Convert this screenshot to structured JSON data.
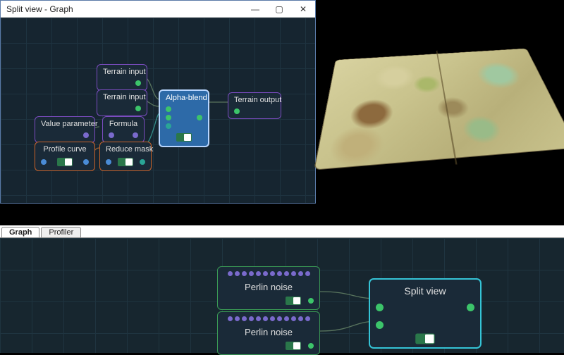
{
  "window": {
    "title": "Split view - Graph",
    "buttons": {
      "min": "—",
      "max": "▢",
      "close": "✕"
    }
  },
  "top_nodes": {
    "terrain_input_1": "Terrain input",
    "terrain_input_2": "Terrain input",
    "value_parameter": "Value parameter",
    "formula": "Formula",
    "profile_curve": "Profile curve",
    "reduce_mask": "Reduce mask",
    "alpha_blend": "Alpha-blend",
    "terrain_output": "Terrain output"
  },
  "tabs": {
    "graph": "Graph",
    "profiler": "Profiler"
  },
  "bottom_nodes": {
    "perlin_1": "Perlin noise",
    "perlin_2": "Perlin noise",
    "split_view": "Split view"
  },
  "colors": {
    "purple": "#7b4cc0",
    "orange": "#c8632a",
    "green": "#3a9a55",
    "cyan": "#35c4d6",
    "blue_node": "#2d6aa8"
  }
}
